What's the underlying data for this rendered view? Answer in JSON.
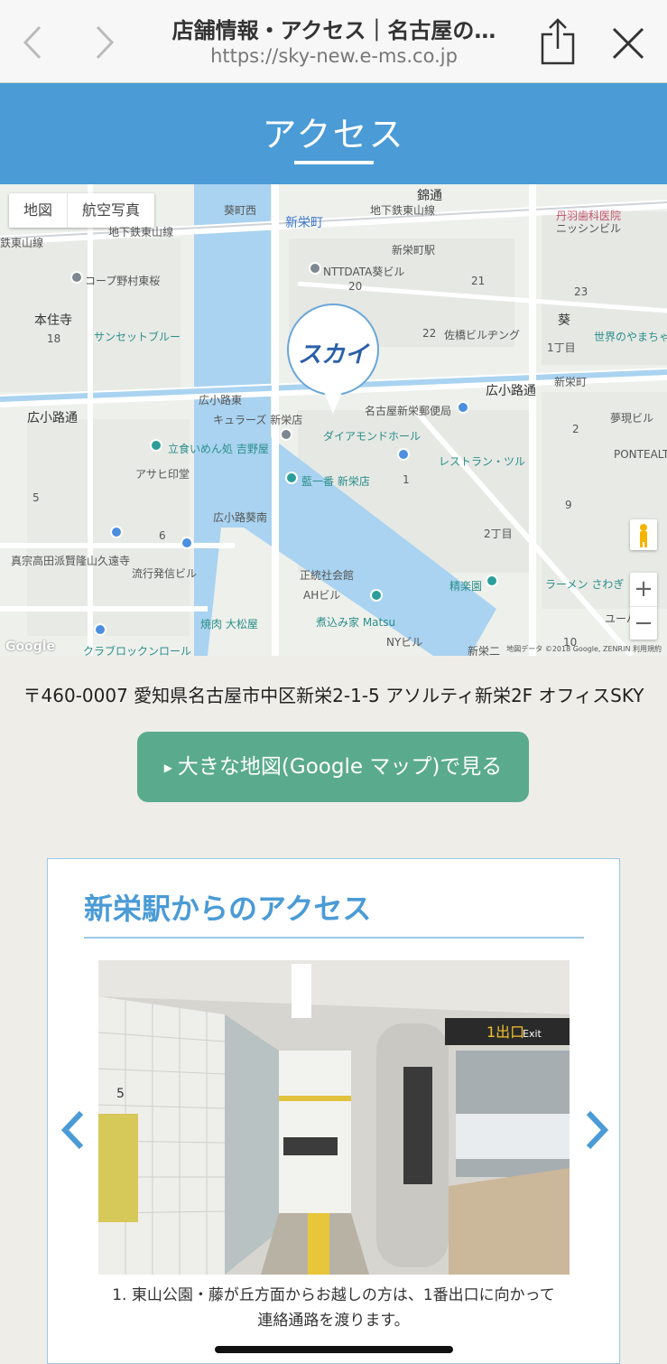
{
  "browser": {
    "title": "店舗情報・アクセス｜名古屋の…",
    "url": "https://sky-new.e-ms.co.jp"
  },
  "header": {
    "title": "アクセス",
    "accent_color": "#4a9bd6"
  },
  "map": {
    "toggle": [
      "地図",
      "航空写真"
    ],
    "marker_logo": "スカイ",
    "labels": [
      "錦通",
      "葵町西",
      "新栄町",
      "地下鉄東山線",
      "地下鉄東山線",
      "新栄町駅",
      "丹羽歯科医院",
      "ニッシンビル",
      "鉄東山線",
      "コープ野村東桜",
      "NTTDATA葵ビル",
      "20",
      "21",
      "23",
      "葵",
      "本住寺",
      "サンセットブルー",
      "22",
      "佐橋ビルヂング",
      "世界のやまちゃん",
      "1丁目",
      "18",
      "広小路通",
      "広小路通",
      "広小路東",
      "新栄町",
      "名古屋新栄郵便局",
      "夢現ビル",
      "キュラーズ 新栄店",
      "ダイアモンドホール",
      "立食いめん処 吉野屋",
      "2",
      "PONTEALTO東",
      "アサヒ印堂",
      "藍一番 新栄店",
      "1",
      "レストラン・ツル",
      "5",
      "9",
      "6",
      "2丁目",
      "広小路葵南",
      "真宗高田派賢隆山久遠寺",
      "流行発信ビル",
      "正統社会館",
      "精楽園",
      "ラーメン さわぎ",
      "AHビル",
      "焼肉 大松屋",
      "煮込み家 Matsu",
      "クラブロックンロール",
      "NYビル",
      "新栄二",
      "10",
      "ユーハ"
    ],
    "zoom": [
      "+",
      "−"
    ],
    "attribution": "地図データ ©2018 Google, ZENRIN   利用規約",
    "google_logo": "Google"
  },
  "address": "〒460-0007 愛知県名古屋市中区新栄2-1-5 アソルティ新栄2F オフィスSKY",
  "gmap_button": {
    "label": "大きな地図(Google マップ)で見る",
    "color": "#5aaa8e"
  },
  "access": {
    "title": "新栄駅からのアクセス",
    "photo_signs": [
      "1出口",
      "Exit",
      "5"
    ],
    "caption_line1": "1. 東山公園・藤が丘方面からお越しの方は、1番出口に向かって",
    "caption_line2": "連絡通路を渡ります。"
  }
}
